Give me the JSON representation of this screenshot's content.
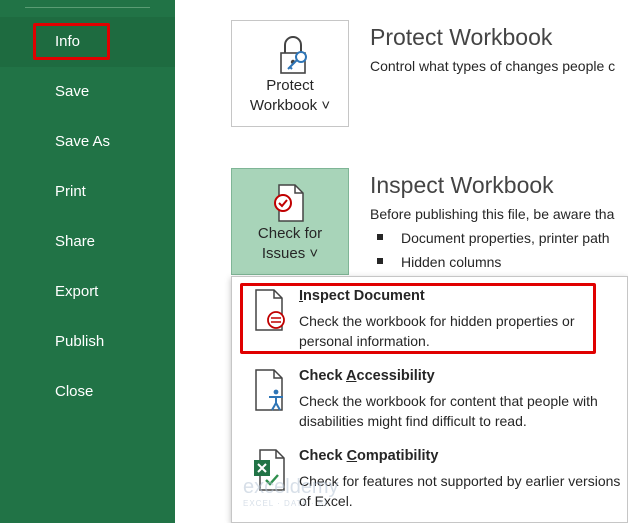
{
  "sidebar": {
    "items": [
      {
        "label": "Info"
      },
      {
        "label": "Save"
      },
      {
        "label": "Save As"
      },
      {
        "label": "Print"
      },
      {
        "label": "Share"
      },
      {
        "label": "Export"
      },
      {
        "label": "Publish"
      },
      {
        "label": "Close"
      }
    ]
  },
  "protect": {
    "tile_line1": "Protect",
    "tile_line2": "Workbook ˅",
    "title": "Protect Workbook",
    "description": "Control what types of changes people c"
  },
  "inspect": {
    "tile_line1": "Check for",
    "tile_line2": "Issues ˅",
    "title": "Inspect Workbook",
    "description": "Before publishing this file, be aware tha",
    "bullets": [
      "Document properties, printer path",
      "Hidden columns"
    ]
  },
  "dropdown": {
    "items": [
      {
        "title_underline": "I",
        "title_rest": "nspect Document",
        "desc": "Check the workbook for hidden properties or personal information."
      },
      {
        "title_prefix": "Check ",
        "title_underline": "A",
        "title_rest": "ccessibility",
        "desc": "Check the workbook for content that people with disabilities might find difficult to read."
      },
      {
        "title_prefix": "Check ",
        "title_underline": "C",
        "title_rest": "ompatibility",
        "desc": "Check for features not supported by earlier versions of Excel."
      }
    ]
  },
  "watermark": {
    "name": "exceldemy",
    "tagline": "EXCEL · DATA · BI"
  },
  "colors": {
    "sidebar": "#217346",
    "highlight": "#e00000",
    "selected_tile": "#a8d4b9"
  }
}
